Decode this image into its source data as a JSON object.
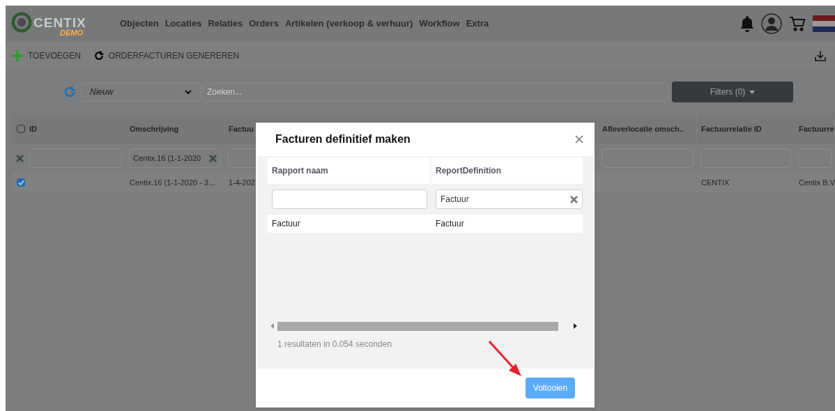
{
  "logo": {
    "name": "CENTIX",
    "tag": "DEMO"
  },
  "nav": [
    "Objecten",
    "Locaties",
    "Relaties",
    "Orders",
    "Artikelen (verkoop & verhuur)",
    "Workflow",
    "Extra"
  ],
  "toolbar": [
    {
      "kind": "add",
      "label": "TOEVOEGEN"
    },
    {
      "kind": "refresh",
      "label": "ORDERFACTUREN GENEREREN"
    }
  ],
  "filter_bar": {
    "view": "Nieuw",
    "search_placeholder": "Zoeken...",
    "filters_button": "Filters (0)"
  },
  "table": {
    "all_checked": false,
    "columns": [
      {
        "label": "ID"
      },
      {
        "label": "Omschrijving",
        "filter": "Centix.16 (1-1-2020"
      },
      {
        "label": "Factuu"
      },
      {
        "label": "Afleverlocatie omsch.."
      },
      {
        "label": "Factuurrelatie ID"
      },
      {
        "label": "Factuurre"
      }
    ],
    "rows": [
      {
        "checked": true,
        "cells": [
          null,
          "Centix.16 (1-1-2020 - 3...",
          "1-4-202",
          null,
          "CENTIX",
          "Centix B.V"
        ]
      }
    ]
  },
  "dialog": {
    "title": "Facturen definitief maken",
    "columns": [
      {
        "label": "Rapport naam"
      },
      {
        "label": "ReportDefinition",
        "filter": "Factuur"
      }
    ],
    "rows": [
      [
        "Factuur",
        "Factuur"
      ]
    ],
    "result_text": "1 resultaten in 0.054 seconden",
    "button": "Voltooien"
  }
}
